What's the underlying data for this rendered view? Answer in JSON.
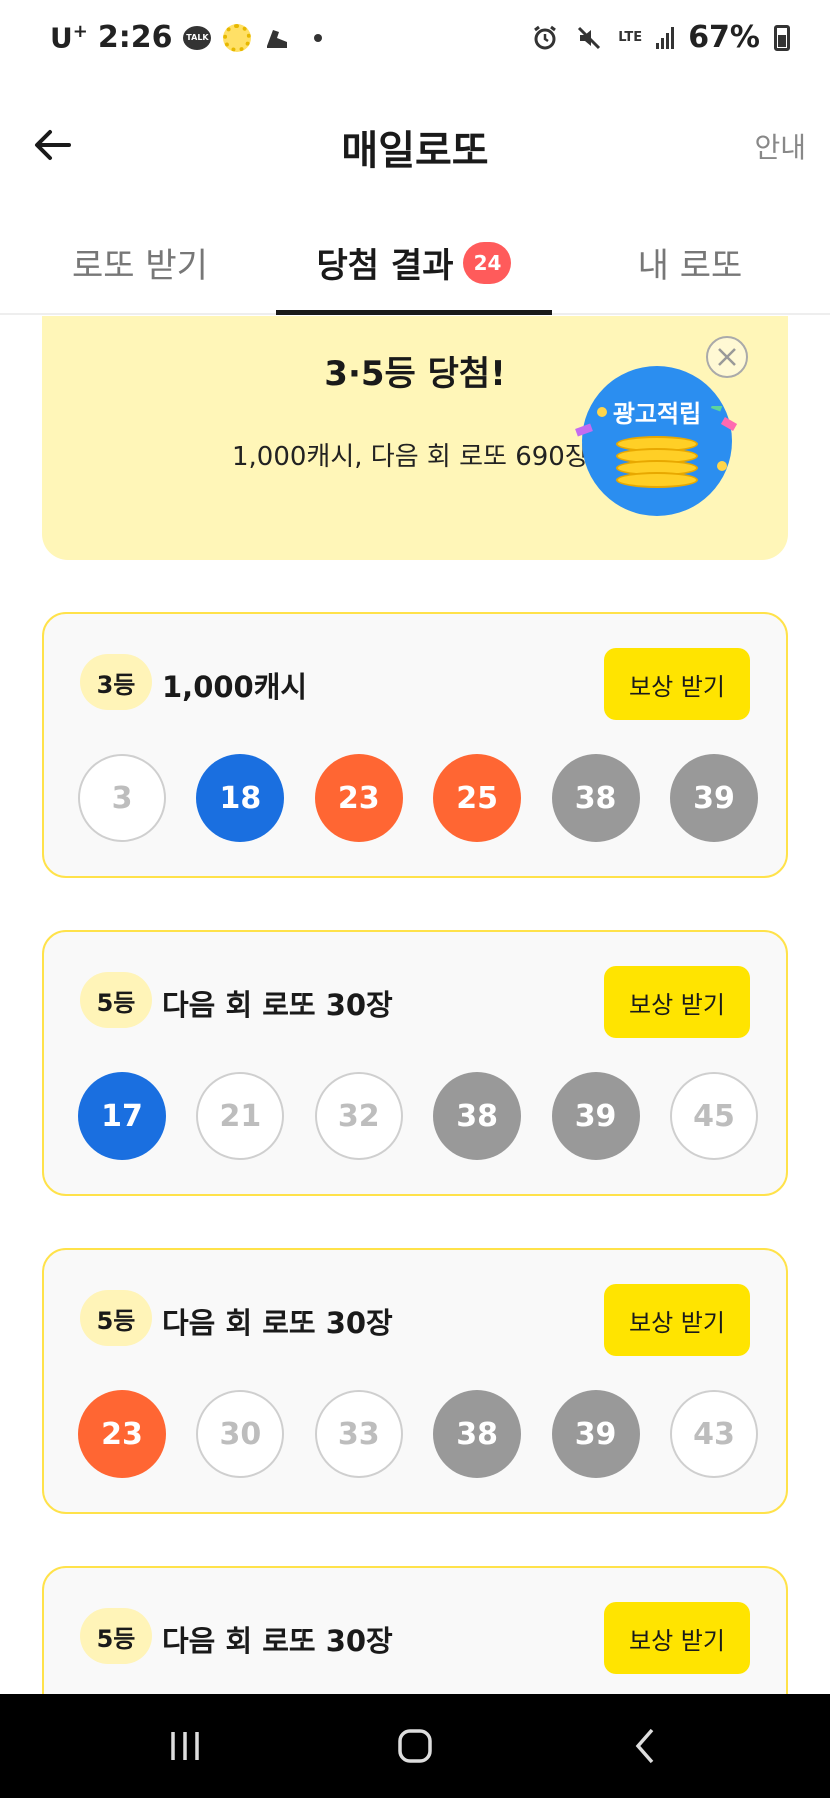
{
  "status_bar": {
    "carrier": "U",
    "carrier_sup": "+",
    "time": "2:26",
    "talk_icon_text": "TALK",
    "network": "LTE",
    "battery": "67%"
  },
  "header": {
    "title": "매일로또",
    "guide_label": "안내"
  },
  "tabs": [
    {
      "label": "로또 받기"
    },
    {
      "label": "당첨 결과",
      "badge": "24"
    },
    {
      "label": "내 로또"
    }
  ],
  "banner": {
    "title": "3·5등 당첨!",
    "description": "1,000캐시, 다음 회 로또 690장",
    "ad_label": "광고적립"
  },
  "results": [
    {
      "rank": "3등",
      "prize": "1,000캐시",
      "button": "보상 받기",
      "balls": [
        {
          "n": "3",
          "state": "miss"
        },
        {
          "n": "18",
          "state": "hit-blue"
        },
        {
          "n": "23",
          "state": "hit-orange"
        },
        {
          "n": "25",
          "state": "hit-orange"
        },
        {
          "n": "38",
          "state": "hit-gray"
        },
        {
          "n": "39",
          "state": "hit-gray"
        }
      ]
    },
    {
      "rank": "5등",
      "prize": "다음 회 로또 30장",
      "button": "보상 받기",
      "balls": [
        {
          "n": "17",
          "state": "hit-blue"
        },
        {
          "n": "21",
          "state": "miss"
        },
        {
          "n": "32",
          "state": "miss"
        },
        {
          "n": "38",
          "state": "hit-gray"
        },
        {
          "n": "39",
          "state": "hit-gray"
        },
        {
          "n": "45",
          "state": "miss"
        }
      ]
    },
    {
      "rank": "5등",
      "prize": "다음 회 로또 30장",
      "button": "보상 받기",
      "balls": [
        {
          "n": "23",
          "state": "hit-orange"
        },
        {
          "n": "30",
          "state": "miss"
        },
        {
          "n": "33",
          "state": "miss"
        },
        {
          "n": "38",
          "state": "hit-gray"
        },
        {
          "n": "39",
          "state": "hit-gray"
        },
        {
          "n": "43",
          "state": "miss"
        }
      ]
    },
    {
      "rank": "5등",
      "prize": "다음 회 로또 30장",
      "button": "보상 받기"
    }
  ],
  "colors": {
    "accent_yellow": "#ffe400",
    "banner_bg": "#fff6b8",
    "ball_blue": "#1a6fe0",
    "ball_orange": "#ff6633",
    "ball_gray": "#999999",
    "badge_red": "#ff5b5b"
  }
}
